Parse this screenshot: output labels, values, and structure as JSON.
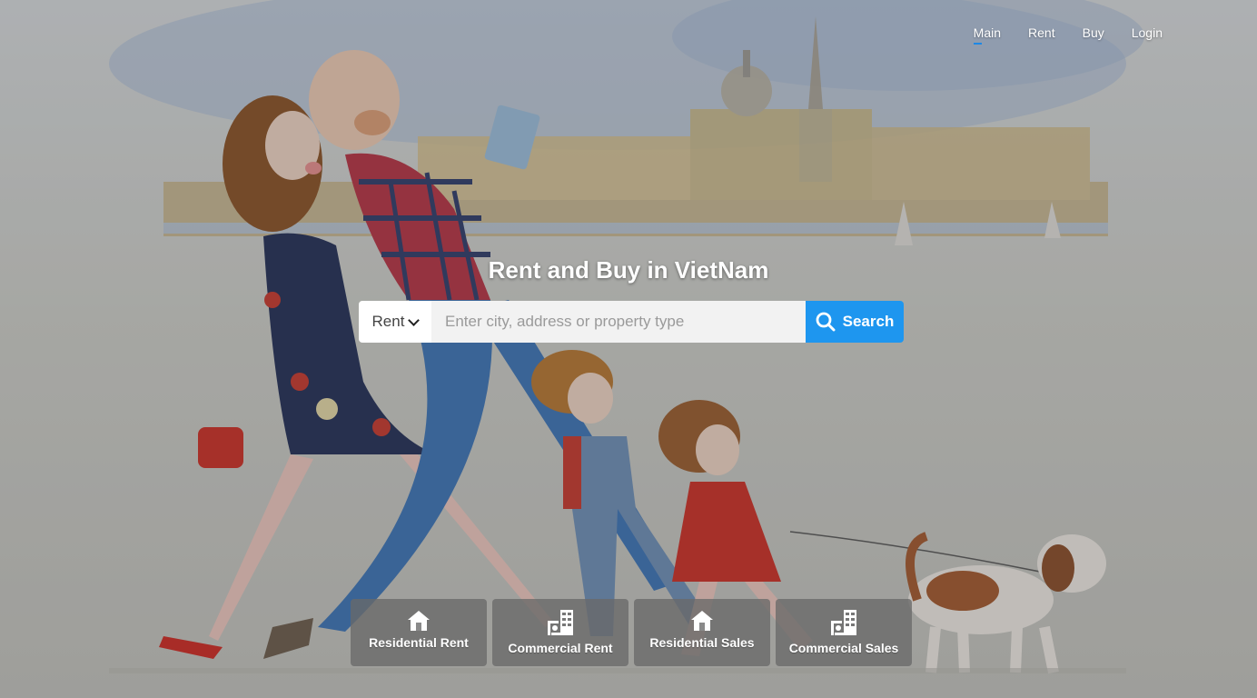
{
  "nav": {
    "items": [
      {
        "label": "Main",
        "active": true
      },
      {
        "label": "Rent",
        "active": false
      },
      {
        "label": "Buy",
        "active": false
      },
      {
        "label": "Login",
        "active": false
      }
    ]
  },
  "hero": {
    "title": "Rent and Buy in VietNam"
  },
  "search": {
    "type_selected": "Rent",
    "placeholder": "Enter city, address or property type",
    "button_label": "Search",
    "button_color": "#1e96ef"
  },
  "categories": [
    {
      "label": "Residential Rent",
      "icon": "house-icon"
    },
    {
      "label": "Commercial Rent",
      "icon": "commercial-building-icon"
    },
    {
      "label": "Residential Sales",
      "icon": "house-icon"
    },
    {
      "label": "Commercial Sales",
      "icon": "commercial-building-icon"
    }
  ]
}
